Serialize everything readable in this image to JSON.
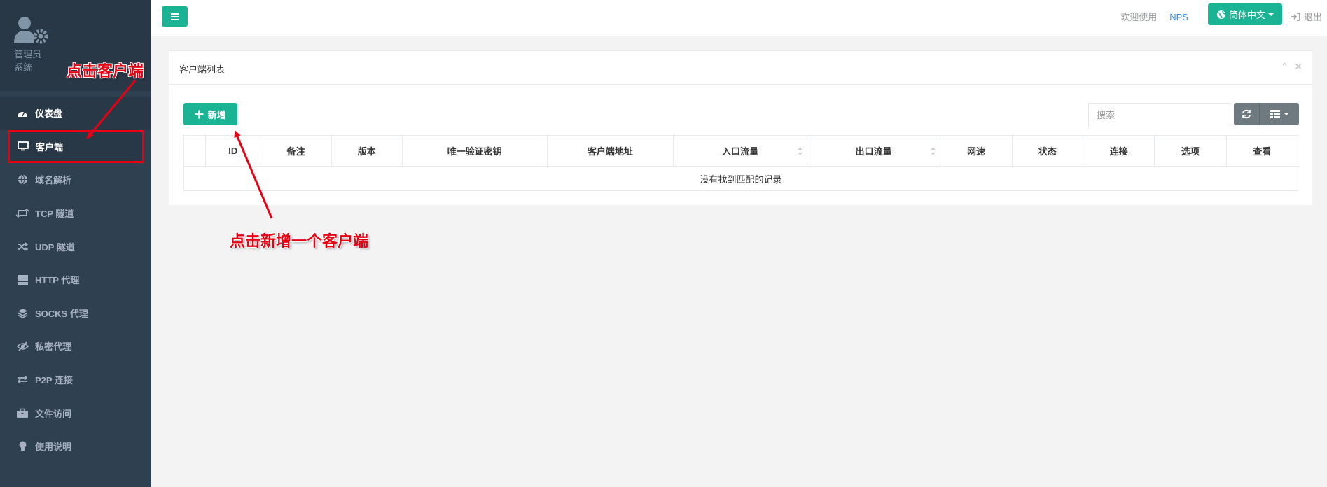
{
  "sidebar": {
    "role": "管理员",
    "system": "系统",
    "items": [
      {
        "label": "仪表盘",
        "icon": "dashboard-icon"
      },
      {
        "label": "客户端",
        "icon": "monitor-icon"
      },
      {
        "label": "域名解析",
        "icon": "globe-icon"
      },
      {
        "label": "TCP 隧道",
        "icon": "retweet-icon"
      },
      {
        "label": "UDP 隧道",
        "icon": "random-icon"
      },
      {
        "label": "HTTP 代理",
        "icon": "server-icon"
      },
      {
        "label": "SOCKS 代理",
        "icon": "layers-icon"
      },
      {
        "label": "私密代理",
        "icon": "eye-slash-icon"
      },
      {
        "label": "P2P 连接",
        "icon": "exchange-icon"
      },
      {
        "label": "文件访问",
        "icon": "briefcase-icon"
      },
      {
        "label": "使用说明",
        "icon": "lightbulb-icon"
      }
    ]
  },
  "topbar": {
    "welcome": "欢迎使用",
    "brand": "NPS",
    "language": "简体中文",
    "logout": "退出"
  },
  "panel": {
    "title": "客户端列表",
    "add_button": "新增",
    "search_placeholder": "搜索",
    "columns": [
      "",
      "ID",
      "备注",
      "版本",
      "唯一验证密钥",
      "客户端地址",
      "入口流量",
      "出口流量",
      "网速",
      "状态",
      "连接",
      "选项",
      "查看"
    ],
    "empty_message": "没有找到匹配的记录"
  },
  "annotations": {
    "click_client": "点击客户端",
    "click_add": "点击新增一个客户端"
  },
  "colors": {
    "sidebar_bg": "#2f4050",
    "accent": "#1ab394",
    "annotation": "#e60012"
  }
}
